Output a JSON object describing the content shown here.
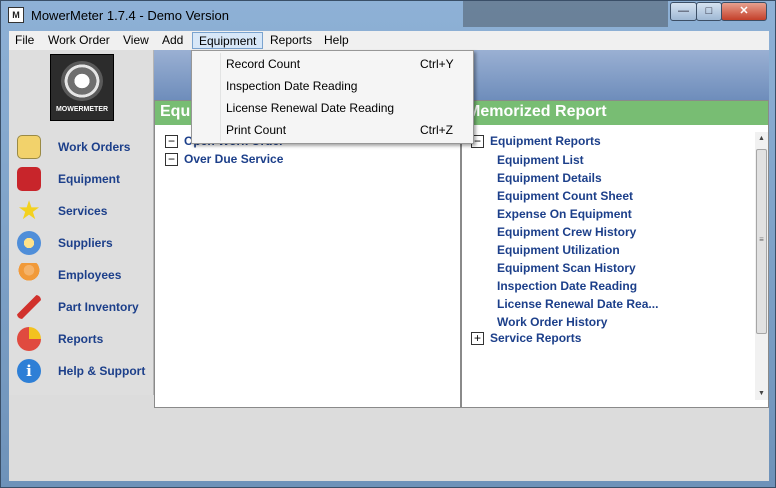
{
  "window": {
    "title": "MowerMeter 1.7.4 - Demo Version",
    "app_icon_text": "M"
  },
  "controls": {
    "minimize": "—",
    "maximize": "□",
    "close": "✕"
  },
  "menubar": {
    "items": [
      "File",
      "Work Order",
      "View",
      "Add",
      "Equipment",
      "Reports",
      "Help"
    ],
    "open_item": "Equipment"
  },
  "dropdown": {
    "items": [
      {
        "label": "Record Count",
        "shortcut": "Ctrl+Y"
      },
      {
        "label": "Inspection Date Reading",
        "shortcut": ""
      },
      {
        "label": "License Renewal Date Reading",
        "shortcut": ""
      },
      {
        "label": "Print Count",
        "shortcut": "Ctrl+Z"
      }
    ]
  },
  "logo": {
    "text": "MOWERMETER"
  },
  "sidebar": {
    "items": [
      {
        "label": "Work Orders",
        "icon": "clipboard-icon",
        "color": "#f2d26b"
      },
      {
        "label": "Equipment",
        "icon": "toolbox-icon",
        "color": "#c8252b"
      },
      {
        "label": "Services",
        "icon": "star-icon",
        "color": "#f3d11f"
      },
      {
        "label": "Suppliers",
        "icon": "globe-icon",
        "color": "#4f8ed9"
      },
      {
        "label": "Employees",
        "icon": "people-icon",
        "color": "#f19a3a"
      },
      {
        "label": "Part Inventory",
        "icon": "wrench-icon",
        "color": "#d1312c"
      },
      {
        "label": "Reports",
        "icon": "pie-chart-icon",
        "color": "#e04a3f"
      },
      {
        "label": "Help & Support",
        "icon": "info-icon",
        "color": "#2e7fd6"
      }
    ]
  },
  "left_pane": {
    "title": "Equi",
    "tree": [
      {
        "label": "Open Work Order",
        "expander": "−"
      },
      {
        "label": "Over Due Service",
        "expander": "−"
      }
    ]
  },
  "right_pane": {
    "title": "Memorized Report",
    "group": {
      "label": "Equipment Reports",
      "expander": "−"
    },
    "reports": [
      "Equipment List",
      "Equipment Details",
      "Equipment Count Sheet",
      "Expense On Equipment",
      "Equipment Crew History",
      "Equipment Utilization",
      "Equipment Scan History",
      "Inspection Date Reading",
      "License Renewal Date Rea...",
      "Work Order History"
    ],
    "next_group": {
      "label": "Service Reports",
      "expander": "+"
    }
  },
  "colors": {
    "accent_green": "#78bd73",
    "link_blue": "#1c3f8a"
  }
}
